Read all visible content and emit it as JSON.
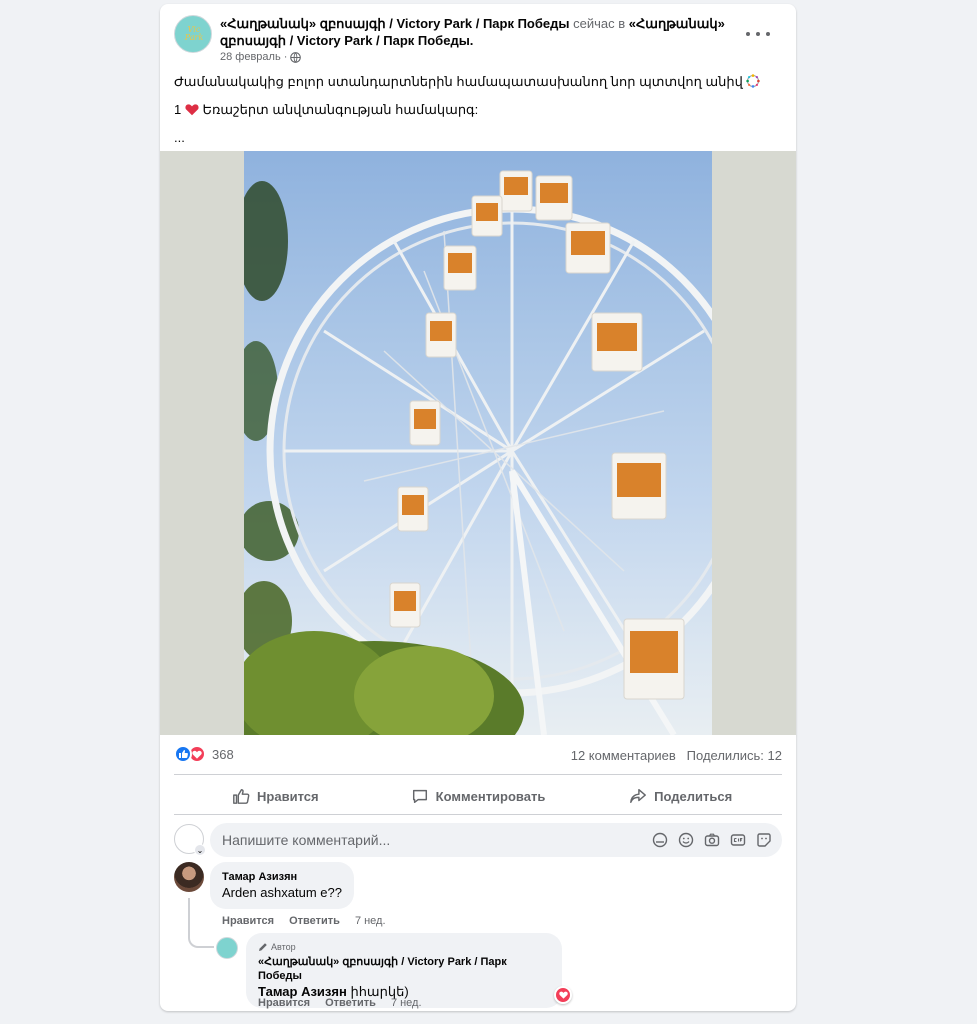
{
  "post": {
    "author_page": "«Հաղթանակ» զբոսայգի / Victory Park / Парк Победы",
    "action_text": "сейчас в",
    "tagged_page": "«Հաղթանակ» զբոսայգի / Victory Park / Парк Победы.",
    "date": "28 февраль",
    "separator": "·",
    "text_line1": "Ժամանակակից բոլոր ստանդարտներին համապատասխանող նոր պտտվող անիվ",
    "text_line2_num": "1",
    "text_line2": "Եռաշերտ անվտանգության համակարգ:",
    "more": "...",
    "icons": {
      "privacy": "globe-icon",
      "menu": "more-horizontal-icon",
      "emoji": "ferris-wheel-emoji",
      "heart": "red-heart-emoji"
    },
    "photo_subject": "ferris-wheel-photo"
  },
  "stats": {
    "reaction_count": "368",
    "comments": "12 комментариев",
    "shares": "Поделились: 12"
  },
  "actions": {
    "like": "Нравится",
    "comment": "Комментировать",
    "share": "Поделиться"
  },
  "composer": {
    "placeholder": "Напишите комментарий..."
  },
  "comments": [
    {
      "author": "Тамар Азизян",
      "text": "Arden ashxatum e??",
      "like": "Нравится",
      "reply": "Ответить",
      "time": "7 нед."
    }
  ],
  "reply": {
    "badge": "Автор",
    "author": "«Հաղթանակ» զբոսայգի / Victory Park / Парк Победы",
    "mention": "Тамар Азизян",
    "text": "իհարկե)",
    "like": "Нравится",
    "reply": "Ответить",
    "time": "7 нед."
  },
  "colors": {
    "brand_blue": "#1877f2",
    "love_red": "#f33e58",
    "muted_text": "#65676b",
    "page_bg": "#f0f2f5"
  }
}
